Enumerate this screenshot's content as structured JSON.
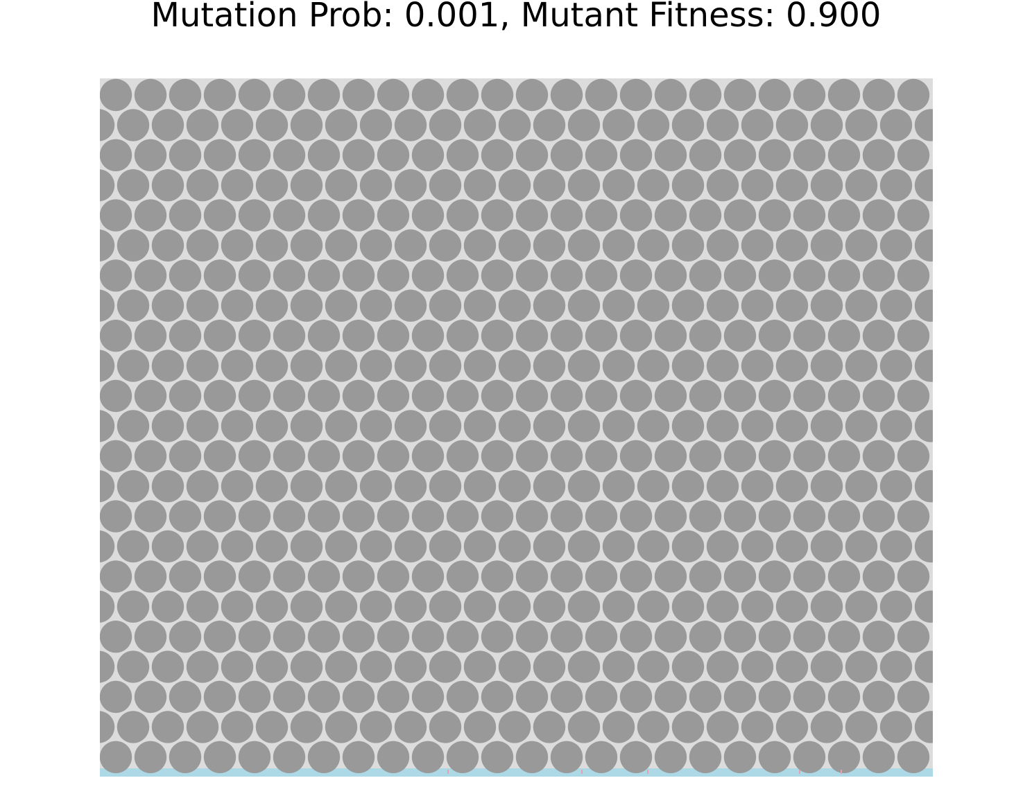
{
  "title": "Mutation Prob: 0.001, Mutant Fitness: 0.900",
  "chart_data": {
    "type": "heatmap",
    "layout": "hexagonal-lattice",
    "title": "Mutation Prob: 0.001, Mutant Fitness: 0.900",
    "axes_visible": false,
    "grid": false,
    "rows": 23,
    "columns": 24,
    "cell_states": {
      "wild_type": "every cell in the lattice",
      "mutant": "none visible"
    },
    "colors": {
      "cell": "#999999",
      "lattice_background": "#dcdcdc",
      "bottom_band": "#add8e6",
      "band_speck": "#e8a0b0"
    }
  }
}
